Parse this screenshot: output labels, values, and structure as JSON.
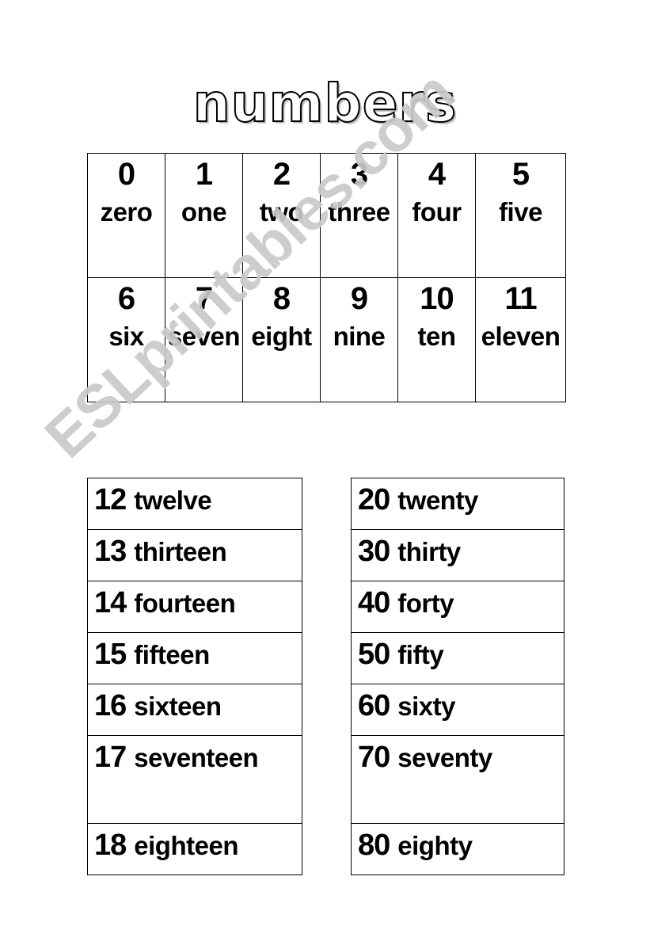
{
  "page": {
    "title": "numbers",
    "watermark": "ESLprintables.com",
    "watermark_color": "#c9c9c9",
    "background_color": "#ffffff",
    "text_color": "#000000"
  },
  "grid_table": {
    "rows": [
      [
        {
          "number": "0",
          "word": "zero"
        },
        {
          "number": "1",
          "word": "one"
        },
        {
          "number": "2",
          "word": "two"
        },
        {
          "number": "3",
          "word": "three"
        },
        {
          "number": "4",
          "word": "four"
        },
        {
          "number": "5",
          "word": "five"
        }
      ],
      [
        {
          "number": "6",
          "word": "six"
        },
        {
          "number": "7",
          "word": "seven"
        },
        {
          "number": "8",
          "word": "eight"
        },
        {
          "number": "9",
          "word": "nine"
        },
        {
          "number": "10",
          "word": "ten"
        },
        {
          "number": "11",
          "word": "eleven"
        }
      ]
    ]
  },
  "list_teens": {
    "rows": [
      {
        "number": "12",
        "word": "twelve"
      },
      {
        "number": "13",
        "word": "thirteen"
      },
      {
        "number": "14",
        "word": "fourteen"
      },
      {
        "number": "15",
        "word": "fifteen"
      },
      {
        "number": "16",
        "word": "sixteen"
      },
      {
        "number": "17",
        "word": "seventeen"
      },
      {
        "number": "18",
        "word": "eighteen"
      }
    ]
  },
  "list_tens": {
    "rows": [
      {
        "number": "20",
        "word": "twenty"
      },
      {
        "number": "30",
        "word": "thirty"
      },
      {
        "number": "40",
        "word": "forty"
      },
      {
        "number": "50",
        "word": "fifty"
      },
      {
        "number": "60",
        "word": "sixty"
      },
      {
        "number": "70",
        "word": "seventy"
      },
      {
        "number": "80",
        "word": "eighty"
      }
    ]
  }
}
